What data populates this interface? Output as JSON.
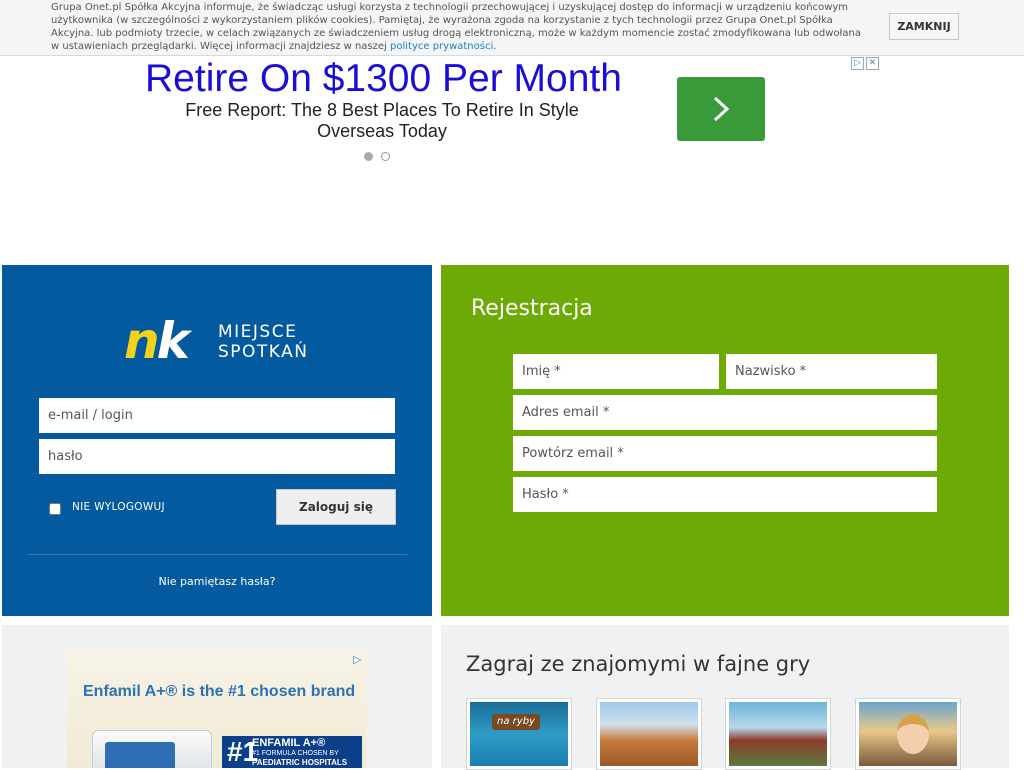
{
  "cookie_bar": {
    "text": "Grupa Onet.pl Spółka Akcyjna informuje, że świadcząc usługi korzysta z technologii przechowującej i uzyskującej dostęp do informacji w urządzeniu końcowym użytkownika (w szczególności z wykorzystaniem plików cookies). Pamiętaj, że wyrażona zgoda na korzystanie z tych technologii przez Grupa Onet.pl Spółka Akcyjna. lub podmioty trzecie, w celach związanych ze świadczeniem usług drogą elektroniczną, może w każdym momencie zostać zmodyfikowana lub odwołana w ustawieniach przeglądarki. Więcej informacji znajdziesz w naszej",
    "link_text": "polityce prywatności",
    "after_link": ".",
    "close_label": "ZAMKNIJ"
  },
  "top_ad": {
    "headline": "Retire On $1300 Per Month",
    "subline": "Free Report: The 8 Best Places To Retire In Style Overseas Today",
    "arrow_icon": "chevron-right-icon",
    "adchoice_icon": "▷",
    "close_icon": "✕",
    "accent": "#3a9a3a"
  },
  "login": {
    "logo_nk": "nk",
    "logo_line1": "MIEJSCE",
    "logo_line2": "SPOTKAŃ",
    "email_placeholder": "e-mail / login",
    "password_placeholder": "hasło",
    "remember_label": "NIE WYLOGOWUJ",
    "submit_label": "Zaloguj się",
    "forgot_label": "Nie pamiętasz hasła?",
    "bg": "#035a9e"
  },
  "register": {
    "title": "Rejestracja",
    "first_name_placeholder": "Imię *",
    "last_name_placeholder": "Nazwisko *",
    "email_placeholder": "Adres email *",
    "email_repeat_placeholder": "Powtórz email *",
    "password_placeholder": "Hasło *",
    "bg": "#6daa05"
  },
  "side_ad": {
    "headline": "Enfamil A+® is the #1 chosen brand",
    "badge_number": "#1",
    "badge_line1": "ENFAMIL A+®",
    "badge_line2": "#1 FORMULA CHOSEN BY",
    "badge_line3": "PAEDIATRIC HOSPITALS",
    "adchoice_icon": "▷"
  },
  "games": {
    "title": "Zagraj ze znajomymi w fajne gry",
    "tiles": [
      {
        "label": "na ryby"
      },
      {
        "label": ""
      },
      {
        "label": ""
      },
      {
        "label": ""
      }
    ]
  }
}
